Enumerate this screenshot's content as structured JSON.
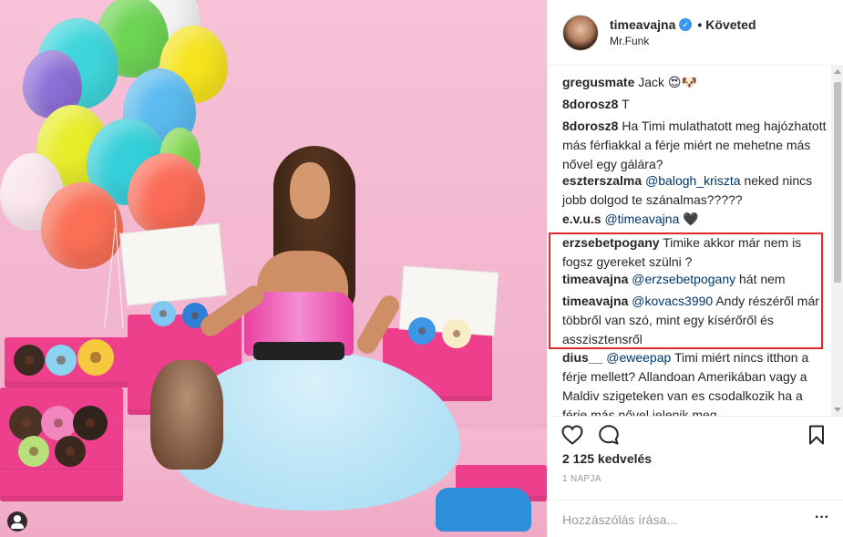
{
  "header": {
    "username": "timeavajna",
    "verified_glyph": "✓",
    "separator": "•",
    "follow_label": "Követed",
    "location": "Mr.Funk"
  },
  "comments": [
    {
      "user": "gregusmate",
      "text": "Jack 😍🐶"
    },
    {
      "user": "8dorosz8",
      "text": "T"
    },
    {
      "user": "8dorosz8",
      "text": "Ha Timi mulathatott meg hajózhatott más férfiakkal a férje miért ne mehetne más nővel egy gálára?"
    },
    {
      "user": "eszterszalma",
      "mention": "@balogh_kriszta",
      "text": "neked nincs jobb dolgod te szánalmas?????"
    },
    {
      "user": "e.v.u.s",
      "mention": "@timeavajna",
      "text": "🖤"
    },
    {
      "user": "erzsebetpogany",
      "text": "Timike akkor már nem is fogsz gyereket szülni ?"
    },
    {
      "user": "timeavajna",
      "mention": "@erzsebetpogany",
      "text": "hát nem"
    },
    {
      "user": "timeavajna",
      "mention": "@kovacs3990",
      "text": "Andy részéről már többről van szó, mint egy kísérőről és asszisztensről"
    },
    {
      "user": "dius__",
      "mention": "@eweepap",
      "text": "Timi miért nincs itthon a férje mellett? Allandoan Amerikában vagy a Maldiv szigeteken van es csodalkozik ha a férje más nővel jelenik meg..."
    }
  ],
  "actions": {
    "like_icon": "heart-icon",
    "comment_icon": "comment-icon",
    "save_icon": "bookmark-icon"
  },
  "likes": "2 125 kedvelés",
  "date": "1 NAPJA",
  "add_comment": {
    "placeholder": "Hozzászólás írása...",
    "more_label": "···"
  },
  "colors": {
    "highlight_border": "#e32929",
    "mention": "#003569",
    "verified": "#3897f0",
    "background_photo": "#f5bcd3"
  }
}
